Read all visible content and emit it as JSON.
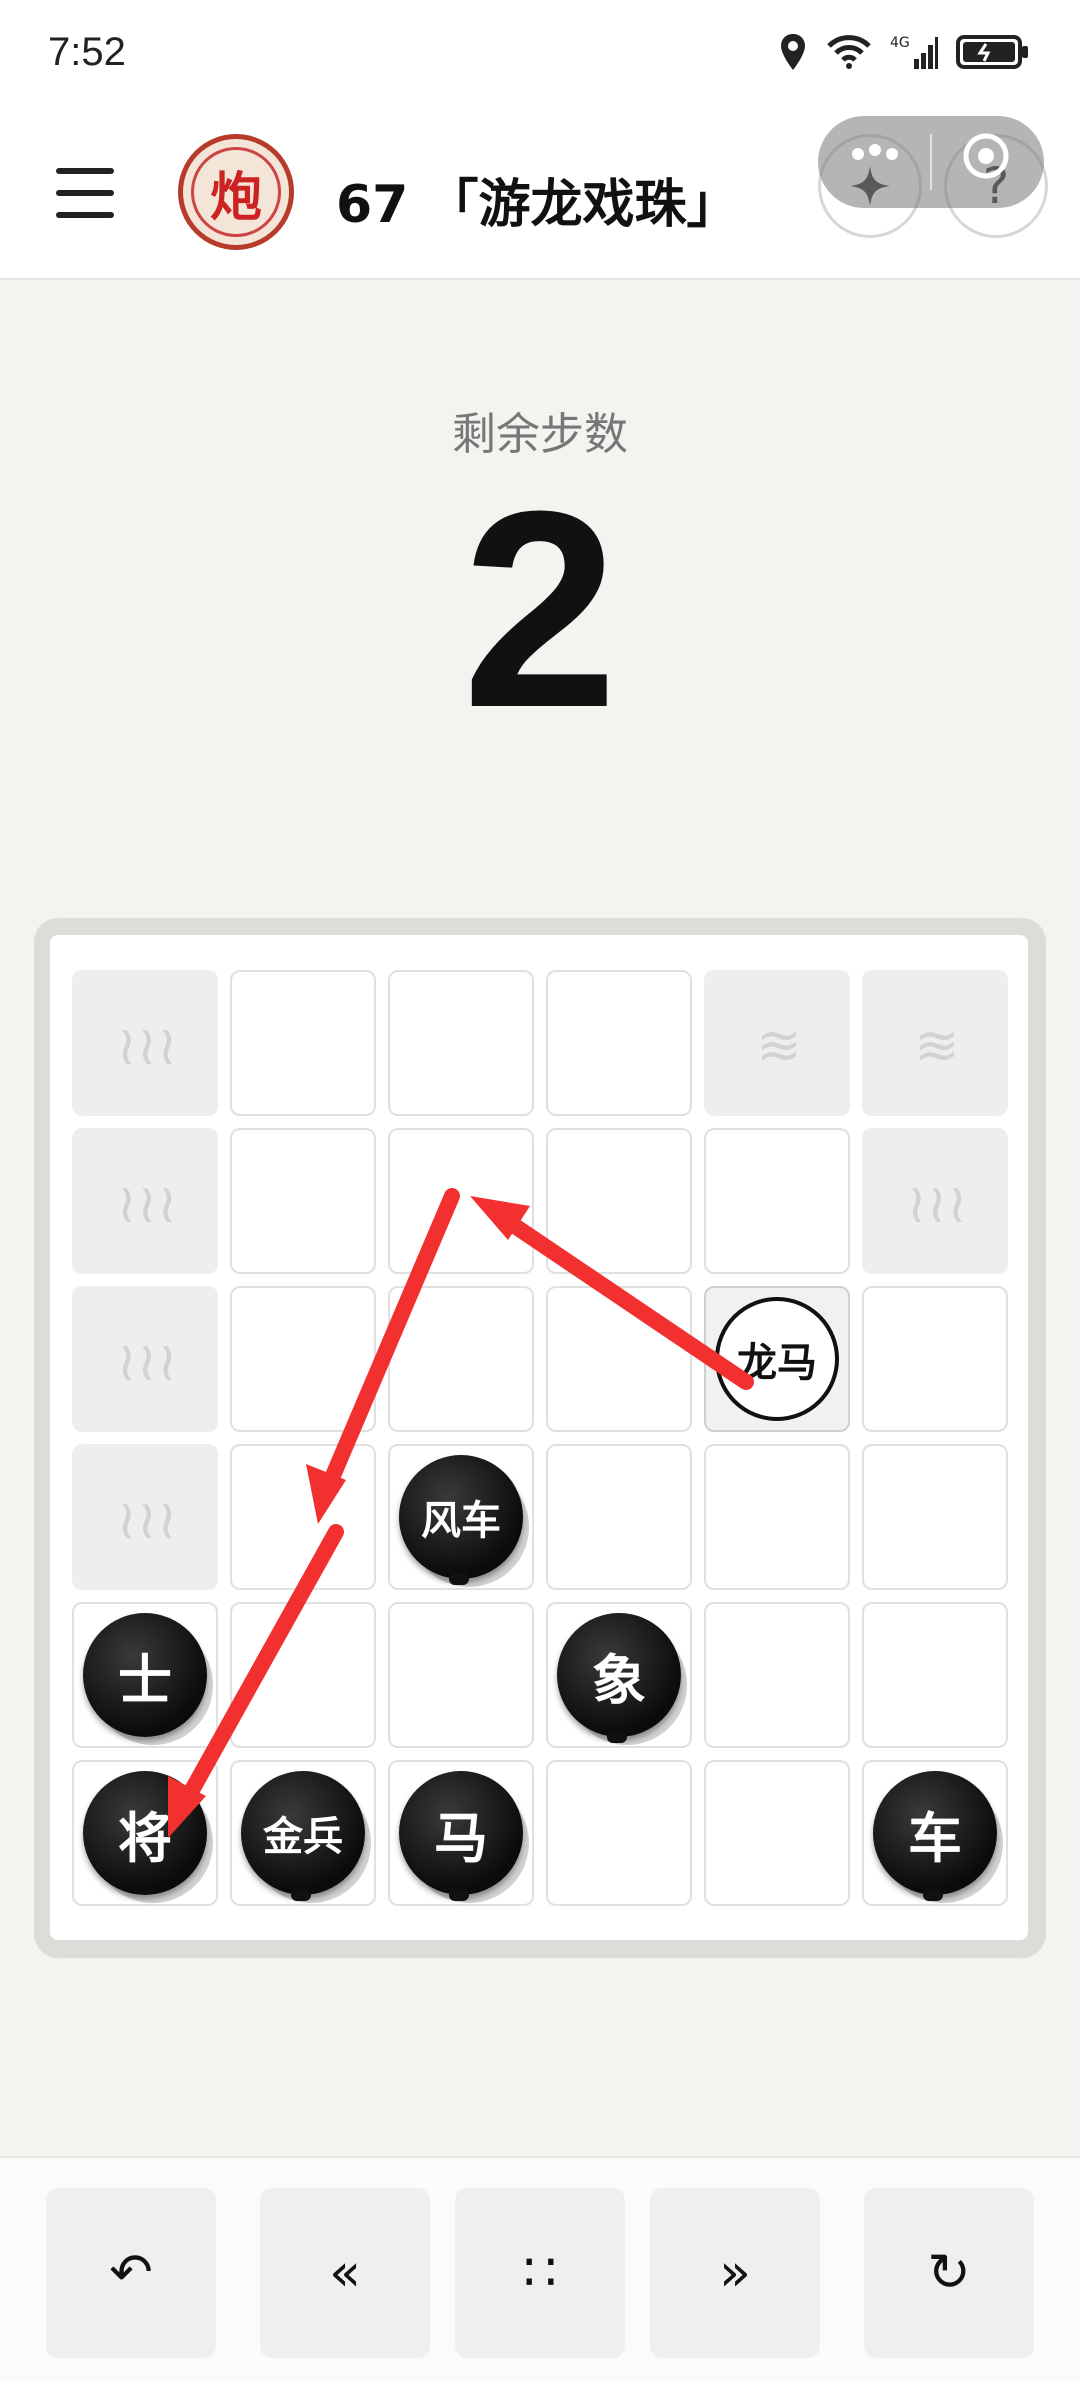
{
  "status_bar": {
    "time": "7:52",
    "icons": [
      "location-icon",
      "wifi-icon",
      "signal-4g-icon",
      "battery-icon"
    ],
    "network_label": "4G"
  },
  "header": {
    "title": "67 「游龙戏珠」",
    "logo_char": "炮",
    "capsule_icons": [
      "more-icon",
      "target-icon"
    ],
    "action_icons": [
      "sparkle-icon",
      "help-icon"
    ],
    "help_glyph": "?"
  },
  "steps": {
    "label": "剩余步数",
    "value": "2"
  },
  "board": {
    "rows": 6,
    "cols": 6,
    "water_cells": [
      [
        0,
        0
      ],
      [
        0,
        4
      ],
      [
        0,
        5
      ],
      [
        1,
        0
      ],
      [
        1,
        5
      ],
      [
        2,
        0
      ],
      [
        3,
        0
      ]
    ],
    "highlight_cells": [
      [
        2,
        4
      ]
    ],
    "pieces": [
      {
        "row": 2,
        "col": 4,
        "label": "龙马",
        "color": "white"
      },
      {
        "row": 3,
        "col": 2,
        "label": "风车",
        "color": "black"
      },
      {
        "row": 4,
        "col": 0,
        "label": "士",
        "color": "black"
      },
      {
        "row": 4,
        "col": 3,
        "label": "象",
        "color": "black"
      },
      {
        "row": 5,
        "col": 0,
        "label": "将",
        "color": "black"
      },
      {
        "row": 5,
        "col": 1,
        "label": "金兵",
        "color": "black"
      },
      {
        "row": 5,
        "col": 2,
        "label": "马",
        "color": "black"
      },
      {
        "row": 5,
        "col": 5,
        "label": "车",
        "color": "black"
      }
    ],
    "arrow_color": "#f23030"
  },
  "toolbar": {
    "buttons": [
      {
        "name": "undo-button",
        "glyph": "↶"
      },
      {
        "name": "first-button",
        "glyph": "«"
      },
      {
        "name": "menu-dots-button",
        "glyph": "∷"
      },
      {
        "name": "last-button",
        "glyph": "»"
      },
      {
        "name": "restart-button",
        "glyph": "↻"
      }
    ]
  }
}
